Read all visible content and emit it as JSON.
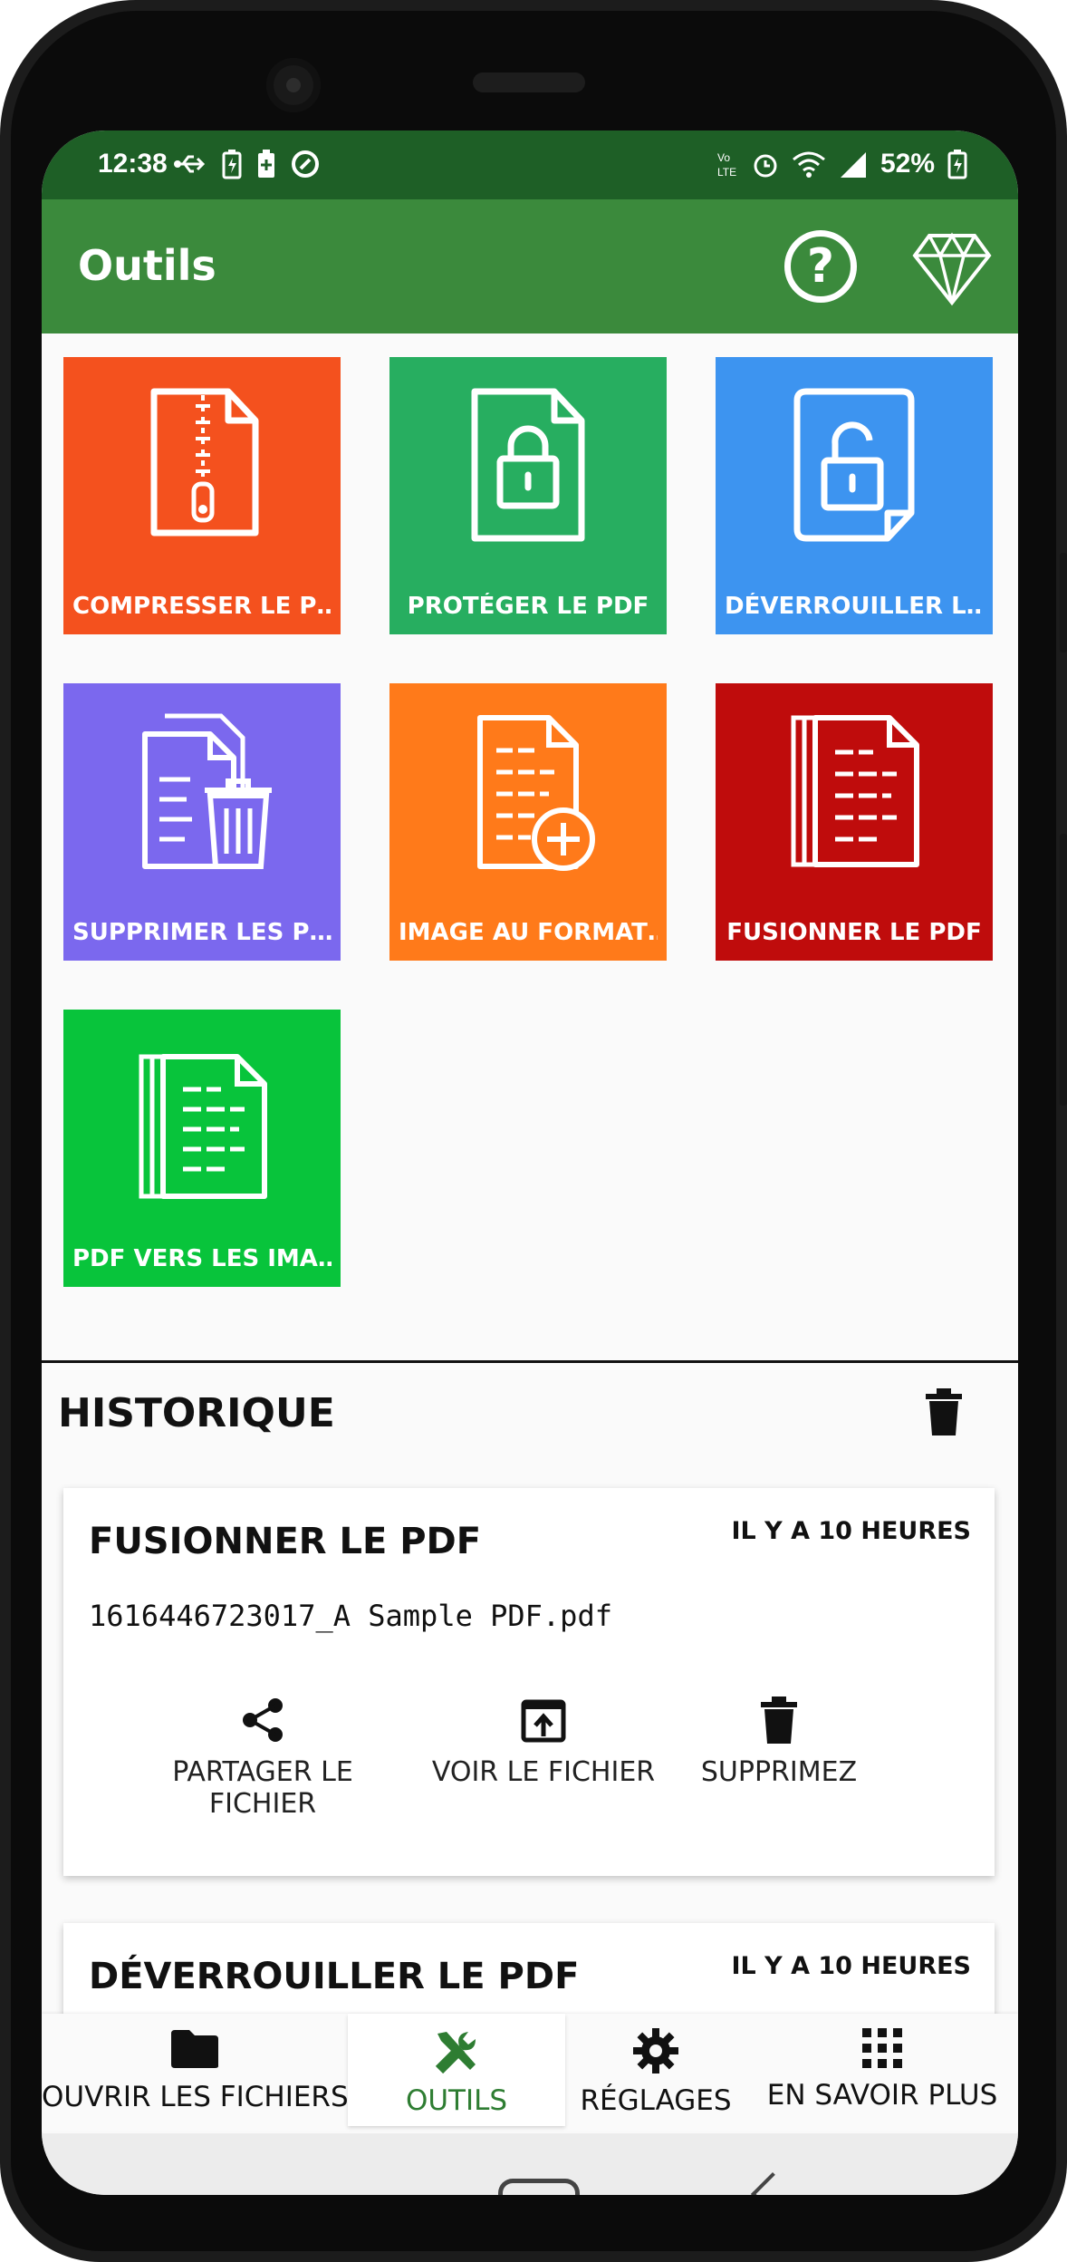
{
  "status": {
    "time": "12:38",
    "battery_pct": "52%"
  },
  "appbar": {
    "title": "Outils",
    "help_icon": "help-circle-icon",
    "premium_icon": "diamond-icon"
  },
  "tools": [
    {
      "label": "COMPRESSER LE P…",
      "color": "#f4511e",
      "icon": "zip-file-icon"
    },
    {
      "label": "PROTÉGER LE PDF",
      "color": "#27ae60",
      "icon": "lock-file-icon"
    },
    {
      "label": "DÉVERROUILLER L…",
      "color": "#3d94f0",
      "icon": "unlock-file-icon"
    },
    {
      "label": "SUPPRIMER LES P…",
      "color": "#7b68ee",
      "icon": "delete-pages-icon"
    },
    {
      "label": "IMAGE AU FORMAT…",
      "color": "#ff7a1a",
      "icon": "add-document-icon"
    },
    {
      "label": "FUSIONNER LE PDF",
      "color": "#bf0c0c",
      "icon": "merge-documents-icon"
    },
    {
      "label": "PDF VERS LES IMA…",
      "color": "#08c43b",
      "icon": "documents-stack-icon"
    }
  ],
  "history": {
    "title": "HISTORIQUE",
    "items": [
      {
        "title": "FUSIONNER LE PDF",
        "time": "IL Y A 10 HEURES",
        "file": "1616446723017_A Sample PDF.pdf",
        "actions": [
          "PARTAGER LE FICHIER",
          "VOIR LE FICHIER",
          "SUPPRIMEZ"
        ]
      },
      {
        "title": "DÉVERROUILLER LE PDF",
        "time": "IL Y A 10 HEURES"
      }
    ]
  },
  "bottom_nav": [
    {
      "label": "OUVRIR LES FICHIERS",
      "icon": "folder-icon",
      "active": false
    },
    {
      "label": "OUTILS",
      "icon": "tools-icon",
      "active": true
    },
    {
      "label": "RÉGLAGES",
      "icon": "gear-icon",
      "active": false
    },
    {
      "label": "EN SAVOIR PLUS",
      "icon": "apps-grid-icon",
      "active": false
    }
  ]
}
